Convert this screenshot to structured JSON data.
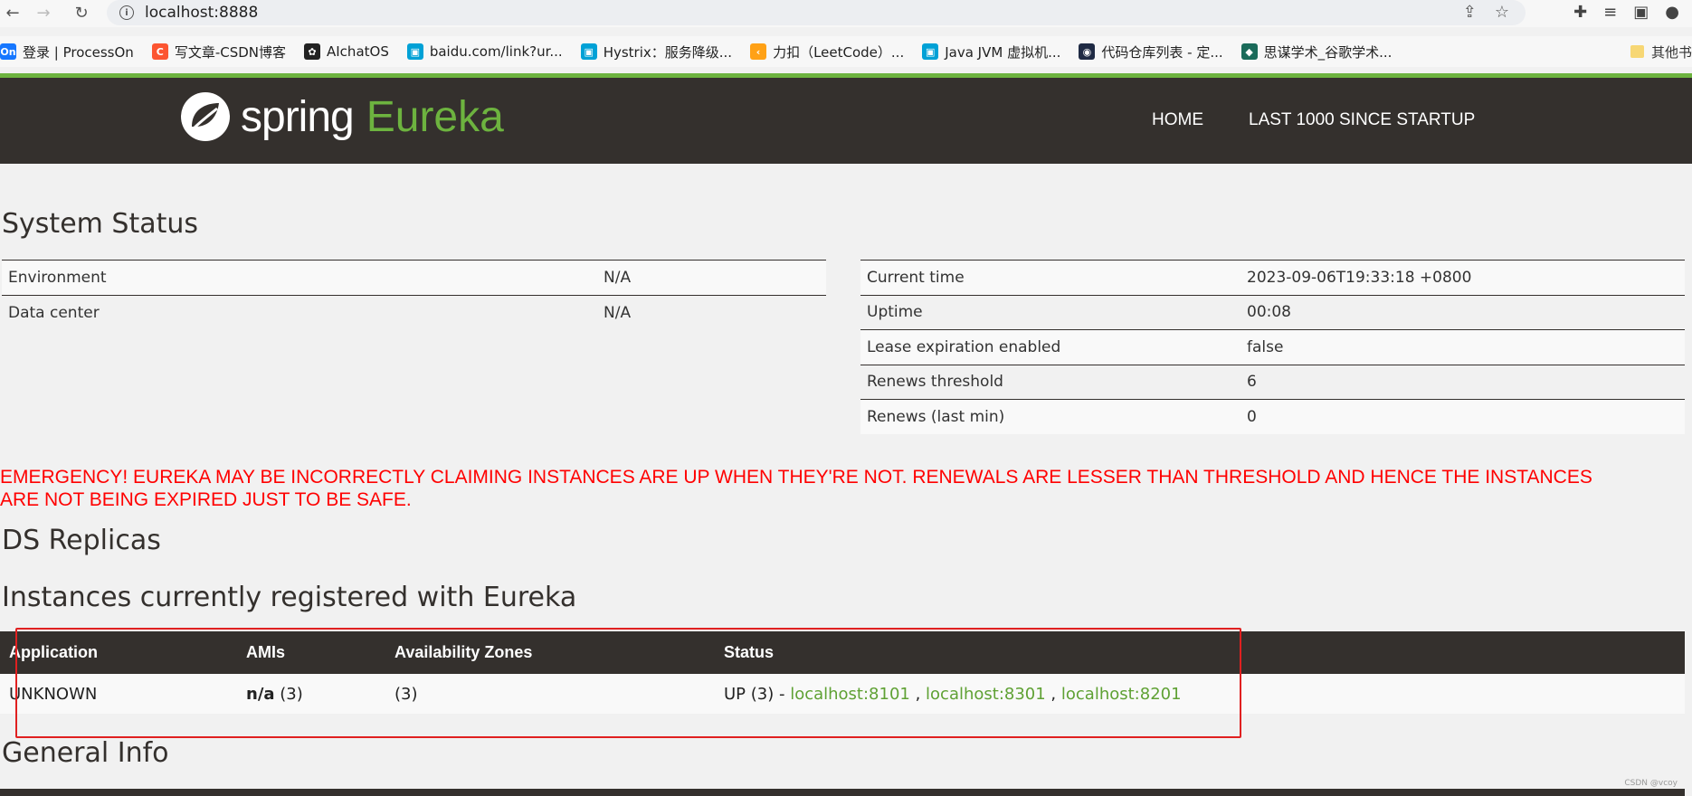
{
  "browser": {
    "url": "localhost:8888",
    "bookmarks": [
      {
        "label": "登录 | ProcessOn",
        "badge": "On",
        "color": "#1677ff"
      },
      {
        "label": "写文章-CSDN博客",
        "badge": "C",
        "color": "#fc5531"
      },
      {
        "label": "AIchatOS",
        "badge": "✿",
        "color": "#222222"
      },
      {
        "label": "baidu.com/link?ur...",
        "badge": "▣",
        "color": "#00a1d6"
      },
      {
        "label": "Hystrix：服务降级...",
        "badge": "▣",
        "color": "#00a1d6"
      },
      {
        "label": "力扣（LeetCode）...",
        "badge": "‹",
        "color": "#ffa116"
      },
      {
        "label": "Java JVM 虚拟机...",
        "badge": "▣",
        "color": "#00a1d6"
      },
      {
        "label": "代码仓库列表 - 定...",
        "badge": "◉",
        "color": "#1f2a44"
      },
      {
        "label": "思谋学术_谷歌学术...",
        "badge": "◆",
        "color": "#1a6b5a"
      }
    ],
    "others_label": "其他书"
  },
  "header": {
    "brand_spring": "spring",
    "brand_eureka": "Eureka",
    "nav_home": "HOME",
    "nav_last": "LAST 1000 SINCE STARTUP"
  },
  "system_status": {
    "title": "System Status",
    "left": [
      {
        "key": "Environment",
        "value": "N/A"
      },
      {
        "key": "Data center",
        "value": "N/A"
      }
    ],
    "right": [
      {
        "key": "Current time",
        "value": "2023-09-06T19:33:18 +0800"
      },
      {
        "key": "Uptime",
        "value": "00:08"
      },
      {
        "key": "Lease expiration enabled",
        "value": "false"
      },
      {
        "key": "Renews threshold",
        "value": "6"
      },
      {
        "key": "Renews (last min)",
        "value": "0"
      }
    ]
  },
  "emergency": "EMERGENCY! EUREKA MAY BE INCORRECTLY CLAIMING INSTANCES ARE UP WHEN THEY'RE NOT. RENEWALS ARE LESSER THAN THRESHOLD AND HENCE THE INSTANCES ARE NOT BEING EXPIRED JUST TO BE SAFE.",
  "ds_replicas_title": "DS Replicas",
  "instances": {
    "title": "Instances currently registered with Eureka",
    "headers": [
      "Application",
      "AMIs",
      "Availability Zones",
      "Status"
    ],
    "row": {
      "application": "UNKNOWN",
      "amis_bold": "n/a",
      "amis_count": " (3)",
      "zones": "(3)",
      "status_prefix": "UP (3) - ",
      "links": [
        "localhost:8101",
        "localhost:8301",
        "localhost:8201"
      ],
      "separator": " , "
    }
  },
  "general_info_title": "General Info",
  "watermark": "CSDN @vcoy"
}
